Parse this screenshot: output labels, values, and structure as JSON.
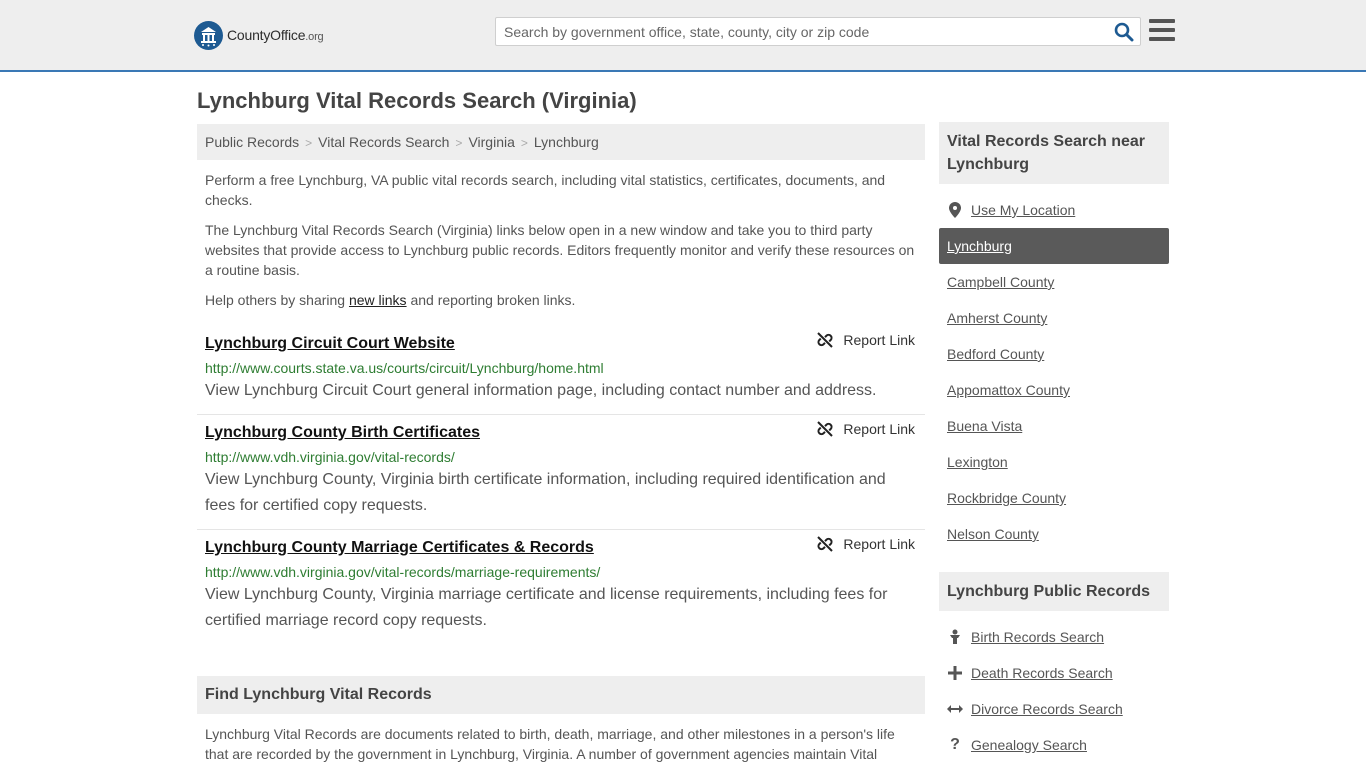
{
  "header": {
    "logo_main": "County",
    "logo_accent": "Office",
    "logo_suffix": ".org",
    "search_placeholder": "Search by government office, state, county, city or zip code"
  },
  "page": {
    "title": "Lynchburg Vital Records Search (Virginia)"
  },
  "breadcrumb": [
    "Public Records",
    "Vital Records Search",
    "Virginia",
    "Lynchburg"
  ],
  "intro": {
    "p1": "Perform a free Lynchburg, VA public vital records search, including vital statistics, certificates, documents, and checks.",
    "p2": "The Lynchburg Vital Records Search (Virginia) links below open in a new window and take you to third party websites that provide access to Lynchburg public records. Editors frequently monitor and verify these resources on a routine basis.",
    "p3_before": "Help others by sharing ",
    "p3_link": "new links",
    "p3_after": " and reporting broken links."
  },
  "records": [
    {
      "title": "Lynchburg Circuit Court Website",
      "url": "http://www.courts.state.va.us/courts/circuit/Lynchburg/home.html",
      "description": "View Lynchburg Circuit Court general information page, including contact number and address.",
      "report": "Report Link"
    },
    {
      "title": "Lynchburg County Birth Certificates",
      "url": "http://www.vdh.virginia.gov/vital-records/",
      "description": "View Lynchburg County, Virginia birth certificate information, including required identification and fees for certified copy requests.",
      "report": "Report Link"
    },
    {
      "title": "Lynchburg County Marriage Certificates & Records",
      "url": "http://www.vdh.virginia.gov/vital-records/marriage-requirements/",
      "description": "View Lynchburg County, Virginia marriage certificate and license requirements, including fees for certified marriage record copy requests.",
      "report": "Report Link"
    }
  ],
  "find": {
    "heading": "Find Lynchburg Vital Records",
    "text": "Lynchburg Vital Records are documents related to birth, death, marriage, and other milestones in a person's life that are recorded by the government in Lynchburg, Virginia. A number of government agencies maintain Vital"
  },
  "sidebar": {
    "near_heading": "Vital Records Search near Lynchburg",
    "use_location": "Use My Location",
    "near_items": [
      "Lynchburg",
      "Campbell County",
      "Amherst County",
      "Bedford County",
      "Appomattox County",
      "Buena Vista",
      "Lexington",
      "Rockbridge County",
      "Nelson County"
    ],
    "public_heading": "Lynchburg Public Records",
    "public_items": [
      {
        "label": "Birth Records Search",
        "icon": "baby-icon"
      },
      {
        "label": "Death Records Search",
        "icon": "cross-icon"
      },
      {
        "label": "Divorce Records Search",
        "icon": "arrows-horizontal-icon"
      },
      {
        "label": "Genealogy Search",
        "icon": "question-icon"
      }
    ]
  }
}
